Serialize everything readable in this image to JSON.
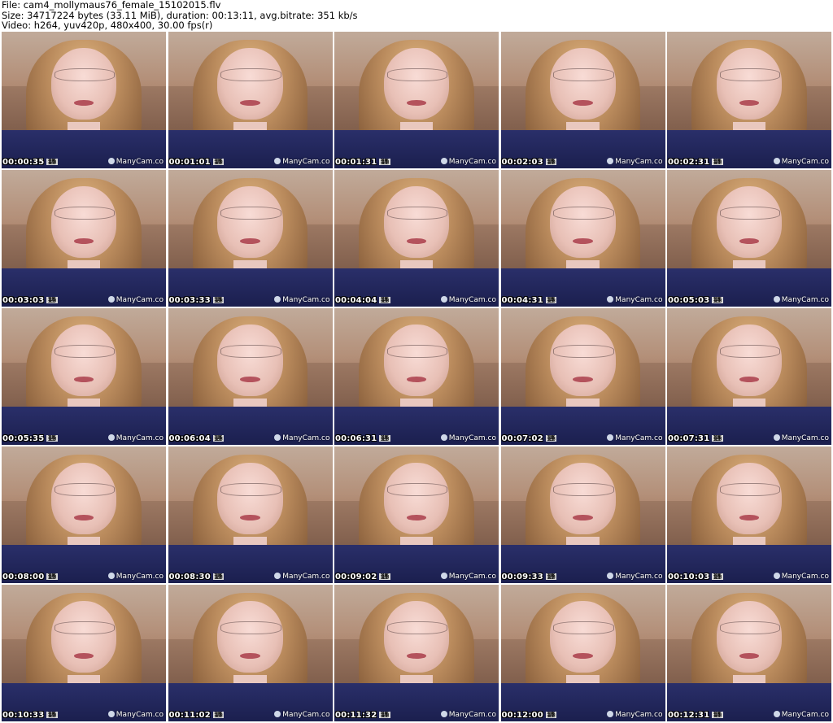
{
  "header": {
    "line1": "File: cam4_mollymaus76_female_15102015.flv",
    "line2": "Size: 34717224 bytes (33.11 MiB), duration: 00:13:11, avg.bitrate: 351 kb/s",
    "line3": "Video: h264, yuv420p, 480x400, 30.00 fps(r)"
  },
  "watermark": "ManyCam.co",
  "badge": "15",
  "thumbnails": [
    {
      "timestamp": "00:00:35"
    },
    {
      "timestamp": "00:01:01"
    },
    {
      "timestamp": "00:01:31"
    },
    {
      "timestamp": "00:02:03"
    },
    {
      "timestamp": "00:02:31"
    },
    {
      "timestamp": "00:03:03"
    },
    {
      "timestamp": "00:03:33"
    },
    {
      "timestamp": "00:04:04"
    },
    {
      "timestamp": "00:04:31"
    },
    {
      "timestamp": "00:05:03"
    },
    {
      "timestamp": "00:05:35"
    },
    {
      "timestamp": "00:06:04"
    },
    {
      "timestamp": "00:06:31"
    },
    {
      "timestamp": "00:07:02"
    },
    {
      "timestamp": "00:07:31"
    },
    {
      "timestamp": "00:08:00"
    },
    {
      "timestamp": "00:08:30"
    },
    {
      "timestamp": "00:09:02"
    },
    {
      "timestamp": "00:09:33"
    },
    {
      "timestamp": "00:10:03"
    },
    {
      "timestamp": "00:10:33"
    },
    {
      "timestamp": "00:11:02"
    },
    {
      "timestamp": "00:11:32"
    },
    {
      "timestamp": "00:12:00"
    },
    {
      "timestamp": "00:12:31"
    }
  ]
}
